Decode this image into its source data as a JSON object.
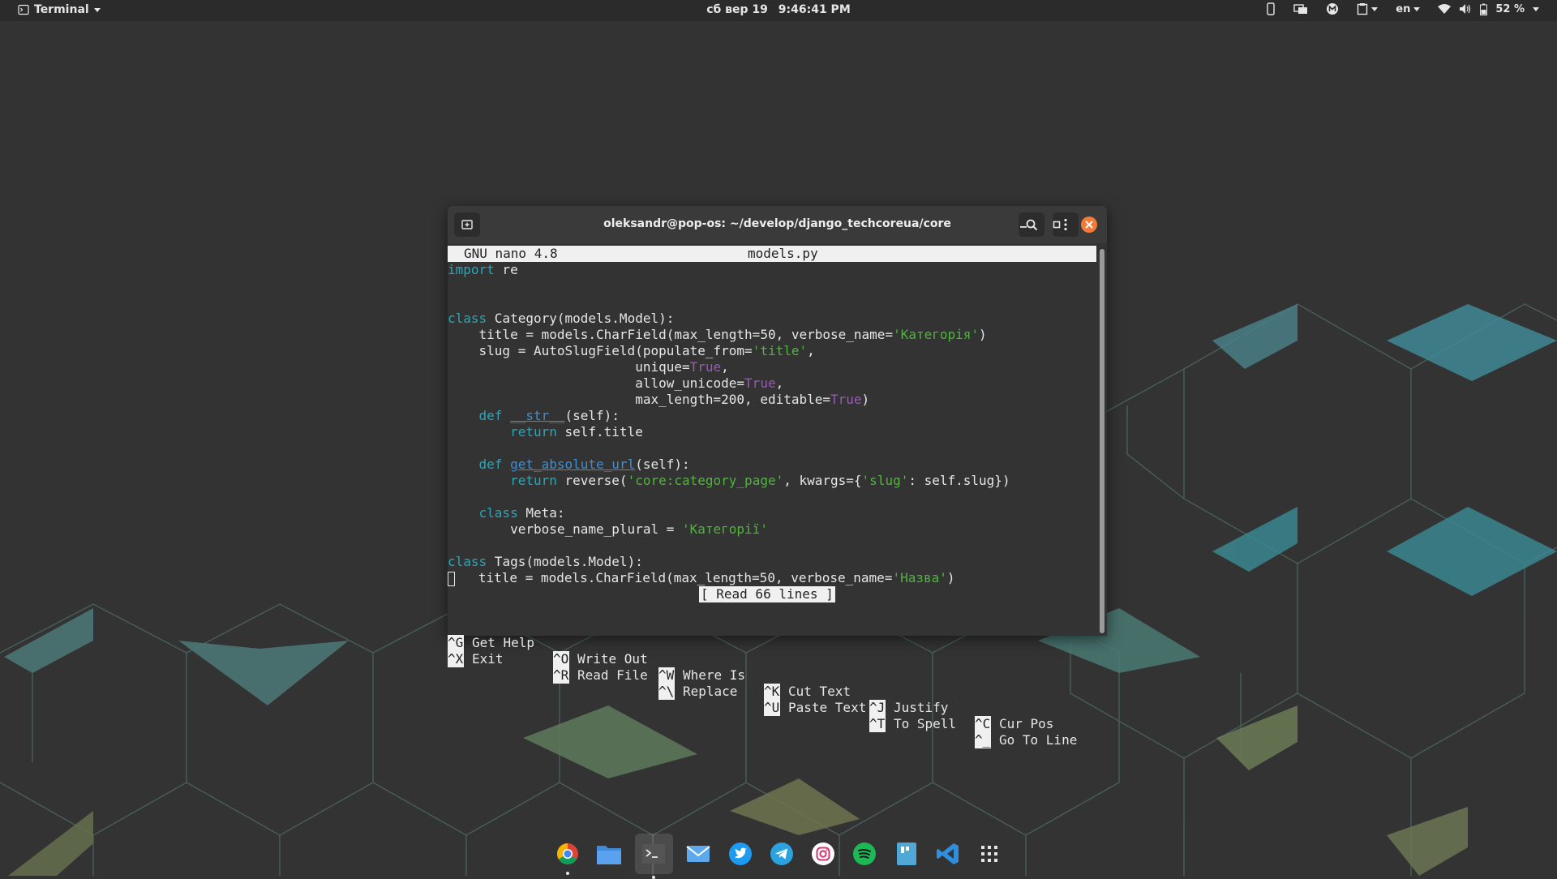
{
  "topbar": {
    "app_menu_label": "Terminal",
    "clock_day": "сб вер 19",
    "clock_time": "9:46:41 PM",
    "keyboard_layout": "en",
    "battery_percent": "52 %",
    "tray_icons": [
      "phone-icon",
      "displays-icon",
      "indicator-m-icon",
      "clipboard-icon",
      "wifi-icon",
      "volume-icon",
      "battery-icon"
    ]
  },
  "terminal": {
    "window_title": "oleksandr@pop-os: ~/develop/django_techcoreua/core"
  },
  "nano": {
    "version": "GNU nano 4.8",
    "filename": "models.py",
    "status_message": "[ Read 66 lines ]",
    "code": {
      "l1_kw": "import",
      "l1_rest": " re",
      "l4_kw": "class",
      "l4_rest": " Category(models.Model):",
      "l5_a": "    title = models.CharField(max_length=50, verbose_name=",
      "l5_str": "'Категорія'",
      "l5_b": ")",
      "l6_a": "    slug = AutoSlugField(populate_from=",
      "l6_str": "'title'",
      "l6_b": ",",
      "l7_a": "                        unique=",
      "l7_bool": "True",
      "l7_b": ",",
      "l8_a": "                        allow_unicode=",
      "l8_bool": "True",
      "l8_b": ",",
      "l9_a": "                        max_length=200, editable=",
      "l9_bool": "True",
      "l9_b": ")",
      "l10_pad": "    ",
      "l10_kw": "def",
      "l10_sp": " ",
      "l10_fn": "__str__",
      "l10_b": "(self):",
      "l11_pad": "        ",
      "l11_kw": "return",
      "l11_b": " self.title",
      "l13_pad": "    ",
      "l13_kw": "def",
      "l13_sp": " ",
      "l13_fn": "get_absolute_url",
      "l13_b": "(self):",
      "l14_pad": "        ",
      "l14_kw": "return",
      "l14_a": " reverse(",
      "l14_str1": "'core:category_page'",
      "l14_m": ", kwargs={",
      "l14_str2": "'slug'",
      "l14_b": ": self.slug})",
      "l16_pad": "    ",
      "l16_kw": "class",
      "l16_b": " Meta:",
      "l17_a": "        verbose_name_plural = ",
      "l17_str": "'Категорії'",
      "l19_kw": "class",
      "l19_b": " Tags(models.Model):",
      "l20_a": "   title = models.CharField(max_length=50, verbose_name=",
      "l20_str": "'Назва'",
      "l20_b": ")"
    },
    "shortcuts": [
      {
        "key": "^G",
        "label": "Get Help"
      },
      {
        "key": "^O",
        "label": "Write Out"
      },
      {
        "key": "^W",
        "label": "Where Is"
      },
      {
        "key": "^K",
        "label": "Cut Text"
      },
      {
        "key": "^J",
        "label": "Justify"
      },
      {
        "key": "^C",
        "label": "Cur Pos"
      },
      {
        "key": "^X",
        "label": "Exit"
      },
      {
        "key": "^R",
        "label": "Read File"
      },
      {
        "key": "^\\",
        "label": "Replace"
      },
      {
        "key": "^U",
        "label": "Paste Text"
      },
      {
        "key": "^T",
        "label": "To Spell"
      },
      {
        "key": "^_",
        "label": "Go To Line"
      }
    ]
  },
  "dock": {
    "apps": [
      "chrome-icon",
      "files-icon",
      "terminal-icon",
      "mail-icon",
      "twitter-icon",
      "telegram-icon",
      "instagram-icon",
      "spotify-icon",
      "document-icon",
      "vscode-icon",
      "app-grid-icon"
    ]
  },
  "colors": {
    "keyword": "#2aa6b8",
    "function": "#3c8fd4",
    "string": "#4fb53c",
    "boolean": "#9b59b6",
    "close_button": "#f47b35"
  }
}
